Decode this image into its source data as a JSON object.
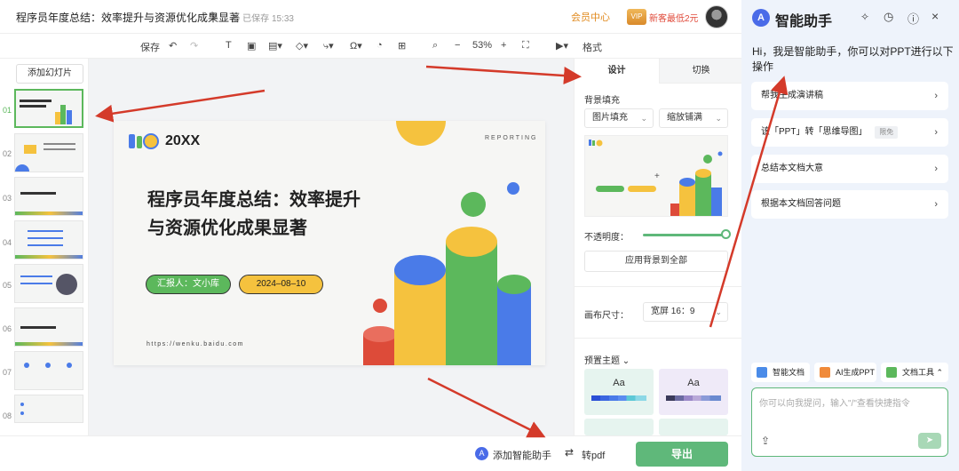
{
  "header": {
    "doc_title": "程序员年度总结：效率提升与资源优化成果显著",
    "saved_status": "已保存 15:33",
    "member_center": "会员中心",
    "vip_badge": "VIP",
    "vip_promo": "新客最低2元"
  },
  "toolbar": {
    "save": "保存",
    "zoom": "53%",
    "format": "格式"
  },
  "thumbnails": {
    "add_slide": "添加幻灯片",
    "numbers": [
      "01",
      "02",
      "03",
      "04",
      "05",
      "06",
      "07",
      "08"
    ]
  },
  "slide": {
    "logo_text": "20XX",
    "reporting": "REPORTING",
    "title": "程序员年度总结：效率提升与资源优化成果显著",
    "reporter": "汇报人：文小库",
    "date": "2024–08–10",
    "url": "https://wenku.baidu.com"
  },
  "design_panel": {
    "tab_design": "设计",
    "tab_switch": "切换",
    "bg_fill_label": "背景填充",
    "fill_type": "图片填充",
    "fill_mode": "缩放铺满",
    "opacity_label": "不透明度：",
    "opacity": 1.0,
    "apply_all": "应用背景到全部",
    "canvas_size_label": "画布尺寸：",
    "canvas_size": "宽屏 16：9",
    "preset_theme": "预置主题",
    "theme_sample": "Aa"
  },
  "bottom": {
    "add_assistant": "添加智能助手",
    "to_pdf": "转pdf",
    "export": "导出"
  },
  "assistant": {
    "title": "智能助手",
    "greeting": "Hi，我是智能助手，你可以对PPT进行以下操作",
    "items": [
      {
        "label": "帮我生成演讲稿",
        "tag": ""
      },
      {
        "label": "该「PPT」转「思维导图」",
        "tag": "限免"
      },
      {
        "label": "总结本文档大意",
        "tag": ""
      },
      {
        "label": "根据本文档回答问题",
        "tag": ""
      }
    ],
    "chips": [
      "智能文档",
      "AI生成PPT",
      "文档工具"
    ],
    "input_placeholder": "你可以向我提问，输入\"/\"查看快捷指令"
  },
  "colors": {
    "green": "#5cb85c",
    "yellow": "#f5c23e",
    "blue": "#4a7be8",
    "red": "#dd4b39",
    "accent_orange": "#e08a1e",
    "arrow_red": "#d43a2a"
  }
}
